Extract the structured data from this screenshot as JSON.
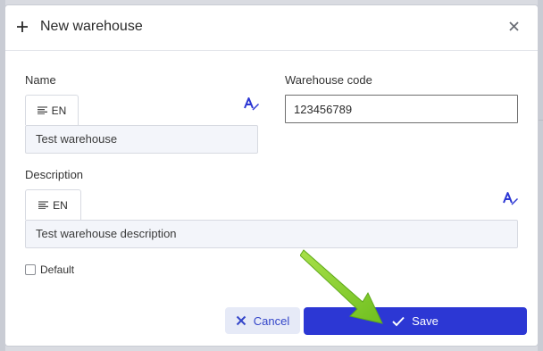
{
  "dialog": {
    "title": "New warehouse",
    "icons": {
      "title_icon": "plus-icon",
      "close_icon": "close-icon",
      "translate_icon": "translate-icon",
      "language_icon": "text-lines-icon"
    }
  },
  "form": {
    "name": {
      "label": "Name",
      "lang_tab": "EN",
      "value": "Test warehouse"
    },
    "warehouse_code": {
      "label": "Warehouse code",
      "value": "123456789"
    },
    "description": {
      "label": "Description",
      "lang_tab": "EN",
      "value": "Test warehouse description"
    },
    "default": {
      "label": "Default",
      "checked": false
    }
  },
  "actions": {
    "cancel_label": "Cancel",
    "save_label": "Save"
  },
  "colors": {
    "primary": "#2c37d4",
    "cancel_bg": "#e6eaf7",
    "annotation_arrow": "#8fd12e"
  }
}
